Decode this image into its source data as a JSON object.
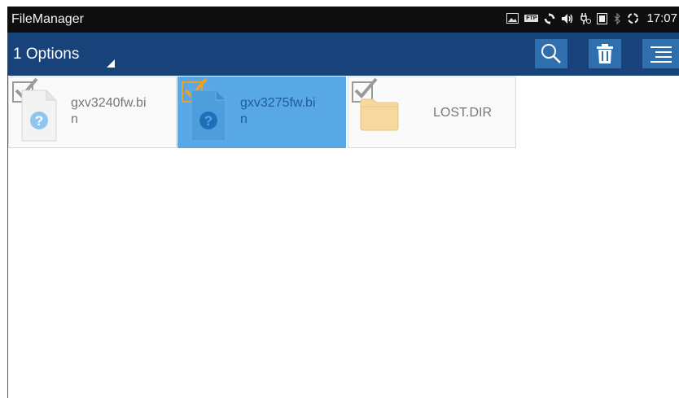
{
  "statusbar": {
    "app_title": "FileManager",
    "time": "17:07",
    "icons": [
      "image-icon",
      "ftp-icon",
      "sync-icon",
      "volume-icon",
      "usb-icon",
      "sim-icon",
      "bluetooth-icon",
      "loading-icon"
    ],
    "ftp_label": "FTP"
  },
  "actionbar": {
    "options_label": "1 Options",
    "buttons": [
      "search-icon",
      "trash-icon",
      "menu-icon"
    ]
  },
  "files": [
    {
      "name": "gxv3240fw.bin",
      "line1": "gxv3240fw.bi",
      "line2": "n",
      "type": "unknown-file",
      "selected": false,
      "checked": false
    },
    {
      "name": "gxv3275fw.bin",
      "line1": "gxv3275fw.bi",
      "line2": "n",
      "type": "unknown-file",
      "selected": true,
      "checked": true
    },
    {
      "name": "LOST.DIR",
      "line1": "LOST.DIR",
      "line2": "",
      "type": "folder",
      "selected": false,
      "checked": false
    }
  ],
  "colors": {
    "actionbar": "#17427a",
    "button": "#2f6fae",
    "selected_tile": "#58a8e6",
    "check_selected": "#f0a020",
    "check_unselected": "#9a9a9a",
    "folder": "#f7d9a0"
  }
}
